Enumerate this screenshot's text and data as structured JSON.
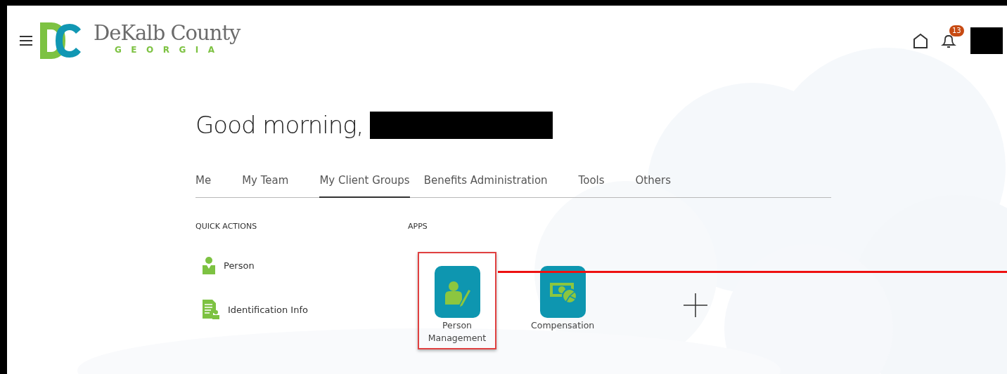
{
  "header": {
    "logo": {
      "name": "DeKalb County",
      "state": "GEORGIA"
    },
    "notifications": {
      "count": "13"
    }
  },
  "greeting": "Good morning,",
  "tabs": [
    {
      "label": "Me",
      "selected": false
    },
    {
      "label": "My Team",
      "selected": false
    },
    {
      "label": "My Client Groups",
      "selected": true
    },
    {
      "label": "Benefits Administration",
      "selected": false
    },
    {
      "label": "Tools",
      "selected": false
    },
    {
      "label": "Others",
      "selected": false
    }
  ],
  "quick_actions": {
    "title": "QUICK ACTIONS",
    "items": [
      {
        "label": "Person",
        "kind": "person"
      },
      {
        "label": "Identification Info",
        "kind": "document"
      }
    ]
  },
  "apps": {
    "title": "APPS",
    "items": [
      {
        "label": "Person Management",
        "kind": "person-edit",
        "highlighted": true
      },
      {
        "label": "Compensation",
        "kind": "money",
        "highlighted": false
      }
    ]
  }
}
